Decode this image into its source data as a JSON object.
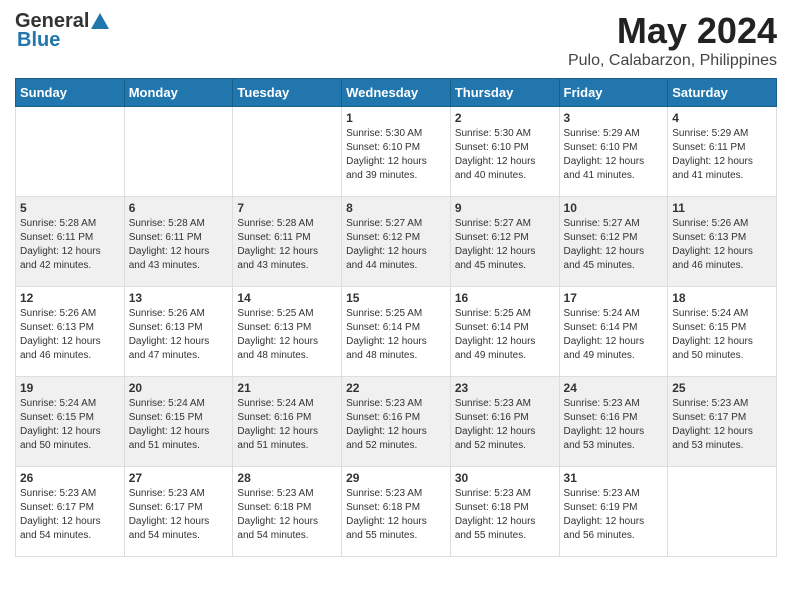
{
  "header": {
    "logo_general": "General",
    "logo_blue": "Blue",
    "title": "May 2024",
    "subtitle": "Pulo, Calabarzon, Philippines"
  },
  "calendar": {
    "days_of_week": [
      "Sunday",
      "Monday",
      "Tuesday",
      "Wednesday",
      "Thursday",
      "Friday",
      "Saturday"
    ],
    "weeks": [
      [
        {
          "day": "",
          "info": ""
        },
        {
          "day": "",
          "info": ""
        },
        {
          "day": "",
          "info": ""
        },
        {
          "day": "1",
          "info": "Sunrise: 5:30 AM\nSunset: 6:10 PM\nDaylight: 12 hours\nand 39 minutes."
        },
        {
          "day": "2",
          "info": "Sunrise: 5:30 AM\nSunset: 6:10 PM\nDaylight: 12 hours\nand 40 minutes."
        },
        {
          "day": "3",
          "info": "Sunrise: 5:29 AM\nSunset: 6:10 PM\nDaylight: 12 hours\nand 41 minutes."
        },
        {
          "day": "4",
          "info": "Sunrise: 5:29 AM\nSunset: 6:11 PM\nDaylight: 12 hours\nand 41 minutes."
        }
      ],
      [
        {
          "day": "5",
          "info": "Sunrise: 5:28 AM\nSunset: 6:11 PM\nDaylight: 12 hours\nand 42 minutes."
        },
        {
          "day": "6",
          "info": "Sunrise: 5:28 AM\nSunset: 6:11 PM\nDaylight: 12 hours\nand 43 minutes."
        },
        {
          "day": "7",
          "info": "Sunrise: 5:28 AM\nSunset: 6:11 PM\nDaylight: 12 hours\nand 43 minutes."
        },
        {
          "day": "8",
          "info": "Sunrise: 5:27 AM\nSunset: 6:12 PM\nDaylight: 12 hours\nand 44 minutes."
        },
        {
          "day": "9",
          "info": "Sunrise: 5:27 AM\nSunset: 6:12 PM\nDaylight: 12 hours\nand 45 minutes."
        },
        {
          "day": "10",
          "info": "Sunrise: 5:27 AM\nSunset: 6:12 PM\nDaylight: 12 hours\nand 45 minutes."
        },
        {
          "day": "11",
          "info": "Sunrise: 5:26 AM\nSunset: 6:13 PM\nDaylight: 12 hours\nand 46 minutes."
        }
      ],
      [
        {
          "day": "12",
          "info": "Sunrise: 5:26 AM\nSunset: 6:13 PM\nDaylight: 12 hours\nand 46 minutes."
        },
        {
          "day": "13",
          "info": "Sunrise: 5:26 AM\nSunset: 6:13 PM\nDaylight: 12 hours\nand 47 minutes."
        },
        {
          "day": "14",
          "info": "Sunrise: 5:25 AM\nSunset: 6:13 PM\nDaylight: 12 hours\nand 48 minutes."
        },
        {
          "day": "15",
          "info": "Sunrise: 5:25 AM\nSunset: 6:14 PM\nDaylight: 12 hours\nand 48 minutes."
        },
        {
          "day": "16",
          "info": "Sunrise: 5:25 AM\nSunset: 6:14 PM\nDaylight: 12 hours\nand 49 minutes."
        },
        {
          "day": "17",
          "info": "Sunrise: 5:24 AM\nSunset: 6:14 PM\nDaylight: 12 hours\nand 49 minutes."
        },
        {
          "day": "18",
          "info": "Sunrise: 5:24 AM\nSunset: 6:15 PM\nDaylight: 12 hours\nand 50 minutes."
        }
      ],
      [
        {
          "day": "19",
          "info": "Sunrise: 5:24 AM\nSunset: 6:15 PM\nDaylight: 12 hours\nand 50 minutes."
        },
        {
          "day": "20",
          "info": "Sunrise: 5:24 AM\nSunset: 6:15 PM\nDaylight: 12 hours\nand 51 minutes."
        },
        {
          "day": "21",
          "info": "Sunrise: 5:24 AM\nSunset: 6:16 PM\nDaylight: 12 hours\nand 51 minutes."
        },
        {
          "day": "22",
          "info": "Sunrise: 5:23 AM\nSunset: 6:16 PM\nDaylight: 12 hours\nand 52 minutes."
        },
        {
          "day": "23",
          "info": "Sunrise: 5:23 AM\nSunset: 6:16 PM\nDaylight: 12 hours\nand 52 minutes."
        },
        {
          "day": "24",
          "info": "Sunrise: 5:23 AM\nSunset: 6:16 PM\nDaylight: 12 hours\nand 53 minutes."
        },
        {
          "day": "25",
          "info": "Sunrise: 5:23 AM\nSunset: 6:17 PM\nDaylight: 12 hours\nand 53 minutes."
        }
      ],
      [
        {
          "day": "26",
          "info": "Sunrise: 5:23 AM\nSunset: 6:17 PM\nDaylight: 12 hours\nand 54 minutes."
        },
        {
          "day": "27",
          "info": "Sunrise: 5:23 AM\nSunset: 6:17 PM\nDaylight: 12 hours\nand 54 minutes."
        },
        {
          "day": "28",
          "info": "Sunrise: 5:23 AM\nSunset: 6:18 PM\nDaylight: 12 hours\nand 54 minutes."
        },
        {
          "day": "29",
          "info": "Sunrise: 5:23 AM\nSunset: 6:18 PM\nDaylight: 12 hours\nand 55 minutes."
        },
        {
          "day": "30",
          "info": "Sunrise: 5:23 AM\nSunset: 6:18 PM\nDaylight: 12 hours\nand 55 minutes."
        },
        {
          "day": "31",
          "info": "Sunrise: 5:23 AM\nSunset: 6:19 PM\nDaylight: 12 hours\nand 56 minutes."
        },
        {
          "day": "",
          "info": ""
        }
      ]
    ]
  }
}
